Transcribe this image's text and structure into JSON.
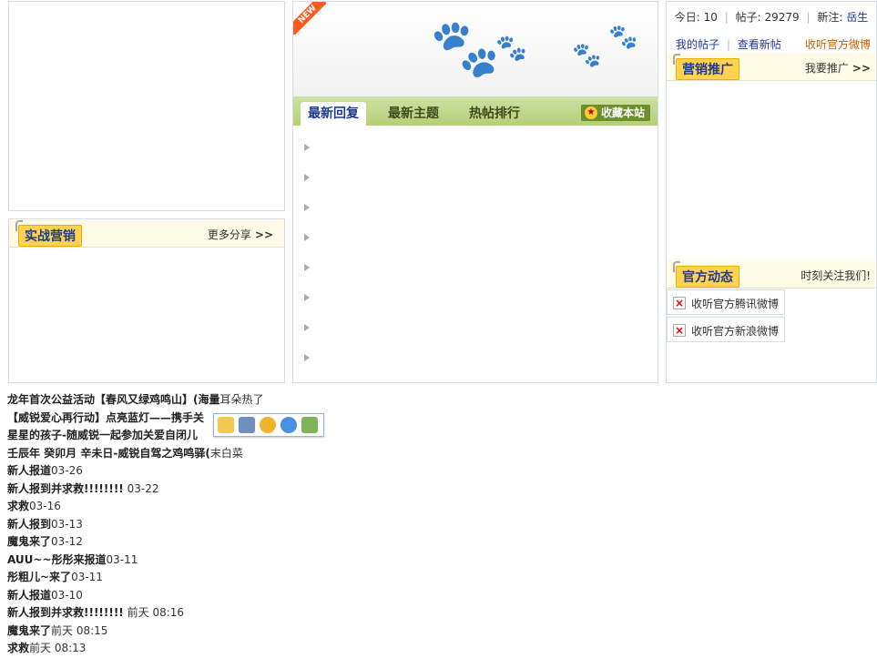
{
  "left": {
    "section_title": "实战营销",
    "more_label": "更多分享",
    "more_arrow": ">>"
  },
  "center": {
    "new_badge": "NEW",
    "tabs": [
      {
        "label": "最新回复",
        "active": true
      },
      {
        "label": "最新主题",
        "active": false
      },
      {
        "label": "热帖排行",
        "active": false
      }
    ],
    "favorite_label": "收藏本站"
  },
  "right": {
    "stats": {
      "today_label": "今日:",
      "today_value": "10",
      "posts_label": "帖子:",
      "posts_value": "29279",
      "newest_label": "新注:",
      "newest_user": "岳生"
    },
    "links": {
      "my_posts": "我的帖子",
      "view_new": "查看新帖",
      "follow_weibo": "收听官方微博"
    },
    "marketing_title": "营销推广",
    "marketing_link": "我要推广",
    "marketing_arrow": ">>",
    "official_title": "官方动态",
    "official_link": "时刻关注我们!",
    "weibo_buttons": [
      "收听官方腾讯微博",
      "收听官方新浪微博"
    ]
  },
  "list": [
    {
      "title": "龙年首次公益活动【春风又绿鸡鸣山】(",
      "extra": "海量",
      "date": "耳朵热了"
    },
    {
      "title": "【威锐爱心再行动】点亮蓝灯——携手关",
      "extra": "",
      "date": ""
    },
    {
      "title": "星星的孩子-随威锐一起参加关爱自闭儿",
      "extra": "",
      "date": ""
    },
    {
      "title": "壬辰年 癸卯月 辛未日-威锐自驾之鸡鸣驿(",
      "extra": "",
      "date": "末白菜"
    },
    {
      "title": "新人报道",
      "extra": "",
      "date": "03-26"
    },
    {
      "title": "新人报到并求救!!!!!!!!",
      "extra": "",
      "date": "03-22"
    },
    {
      "title": "求救",
      "extra": "",
      "date": "03-16"
    },
    {
      "title": "新人报到",
      "extra": "",
      "date": "03-13"
    },
    {
      "title": "魔鬼来了",
      "extra": "",
      "date": "03-12"
    },
    {
      "title": "AUU~~彤彤来报道",
      "extra": "",
      "date": "03-11"
    },
    {
      "title": "彤粗儿~来了",
      "extra": "",
      "date": "03-11"
    },
    {
      "title": "新人报道",
      "extra": "",
      "date": "03-10"
    },
    {
      "title": "新人报到并求救!!!!!!!!",
      "extra": "",
      "date": "前天 08:16"
    },
    {
      "title": "魔鬼来了",
      "extra": "",
      "date": "前天 08:15"
    },
    {
      "title": "求救",
      "extra": "",
      "date": "前天 08:13"
    }
  ],
  "colors": {
    "accent": "#1f3a93",
    "badge": "#ffd34f",
    "tabbar": "#b4cf75"
  },
  "icons": [
    "paw-icon",
    "gold-medal-icon",
    "broken-image-icon",
    "arrow-right-icon",
    "cloud-icon",
    "save-icon",
    "smile-icon",
    "search-icon",
    "note-icon"
  ]
}
